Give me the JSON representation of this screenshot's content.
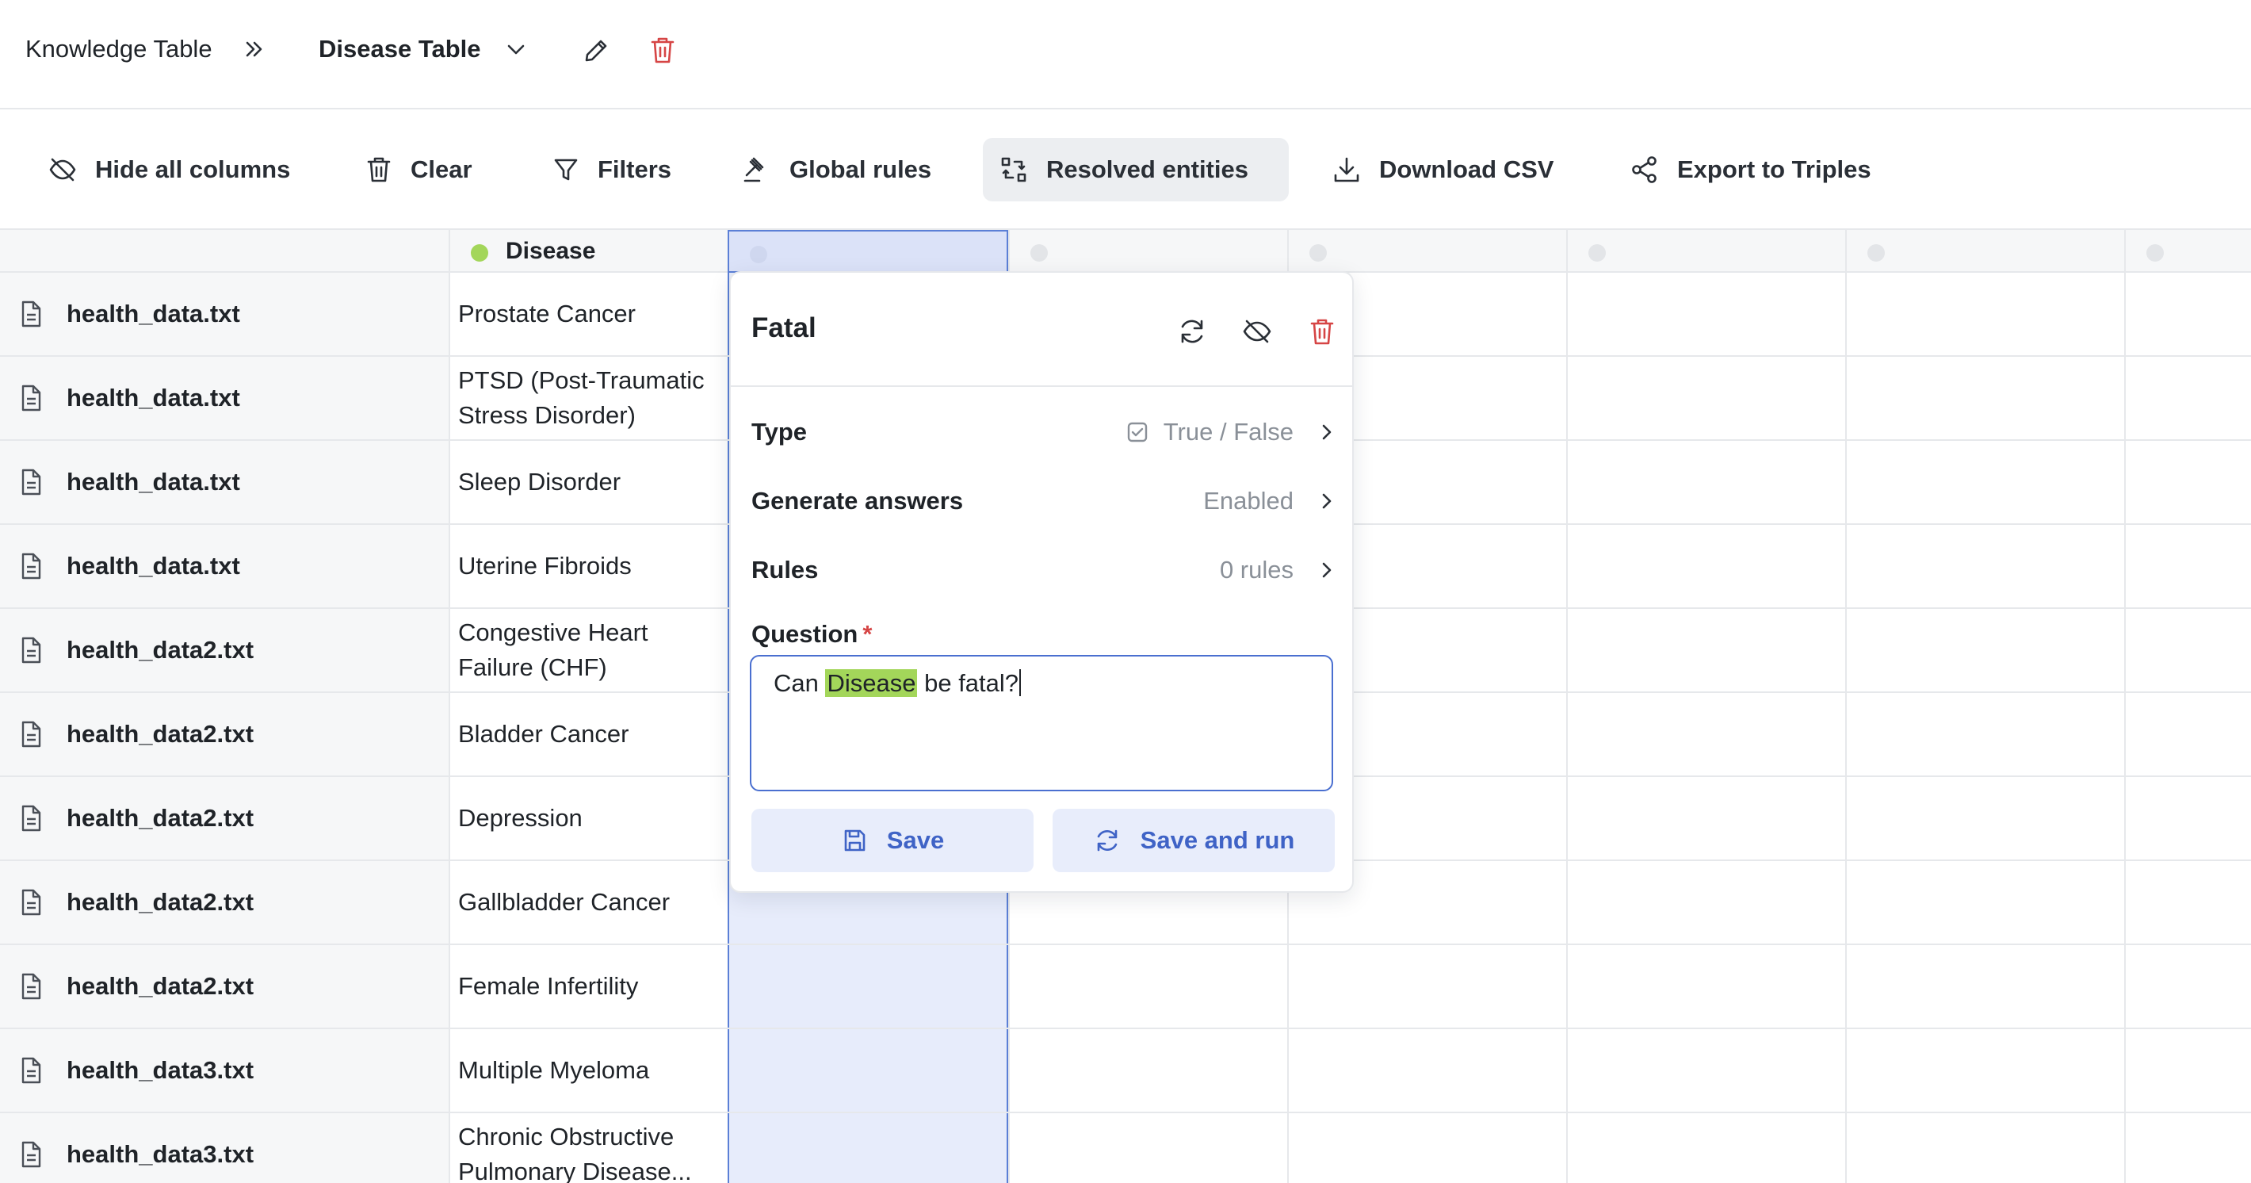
{
  "breadcrumb": {
    "root": "Knowledge Table",
    "current": "Disease Table"
  },
  "toolbar": {
    "hide_all_columns": "Hide all columns",
    "clear": "Clear",
    "filters": "Filters",
    "global_rules": "Global rules",
    "resolved_entities": "Resolved entities",
    "download_csv": "Download CSV",
    "export_to_triples": "Export to Triples"
  },
  "columns": {
    "disease_header": "Disease",
    "status_colors": {
      "active": "#a3d65a",
      "inactive": "#e3e5e8"
    }
  },
  "rows": [
    {
      "file": "health_data.txt",
      "disease": "Prostate Cancer"
    },
    {
      "file": "health_data.txt",
      "disease": "PTSD (Post-Traumatic Stress Disorder)"
    },
    {
      "file": "health_data.txt",
      "disease": "Sleep Disorder"
    },
    {
      "file": "health_data.txt",
      "disease": "Uterine Fibroids"
    },
    {
      "file": "health_data2.txt",
      "disease": "Congestive Heart Failure (CHF)"
    },
    {
      "file": "health_data2.txt",
      "disease": "Bladder Cancer"
    },
    {
      "file": "health_data2.txt",
      "disease": "Depression"
    },
    {
      "file": "health_data2.txt",
      "disease": "Gallbladder Cancer"
    },
    {
      "file": "health_data2.txt",
      "disease": "Female Infertility"
    },
    {
      "file": "health_data3.txt",
      "disease": "Multiple Myeloma"
    },
    {
      "file": "health_data3.txt",
      "disease": "Chronic Obstructive Pulmonary Disease..."
    }
  ],
  "popover": {
    "title": "Fatal",
    "type_label": "Type",
    "type_value": "True / False",
    "generate_label": "Generate answers",
    "generate_value": "Enabled",
    "rules_label": "Rules",
    "rules_value": "0 rules",
    "question_label": "Question",
    "question_required": "*",
    "question_prefix": "Can ",
    "question_entity": "Disease",
    "question_suffix": " be fatal?",
    "save": "Save",
    "save_and_run": "Save and run"
  },
  "colors": {
    "accent": "#3f63c6",
    "accent_bg": "#e8edfb",
    "selected_column": "#e7ecfb",
    "danger": "#d64545",
    "entity_highlight": "#a3d65a"
  }
}
